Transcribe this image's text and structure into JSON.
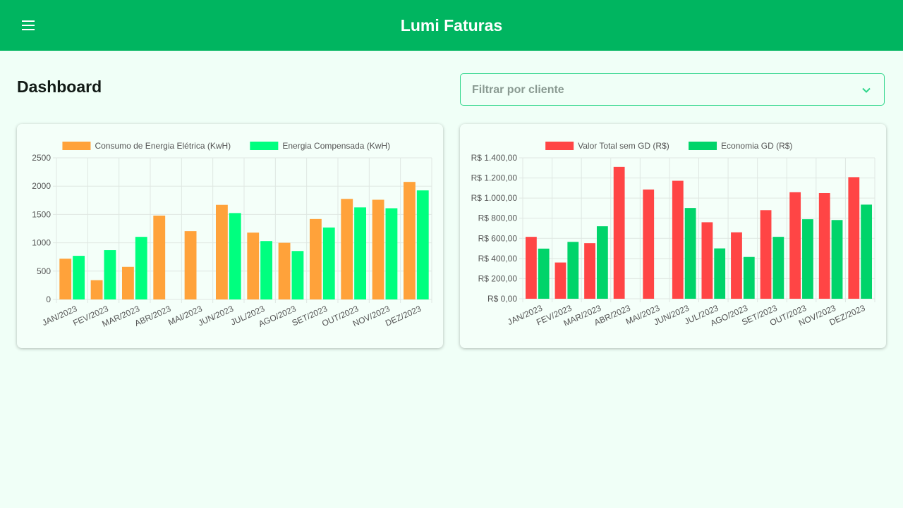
{
  "header": {
    "title": "Lumi Faturas"
  },
  "page": {
    "title": "Dashboard"
  },
  "filter": {
    "placeholder": "Filtrar por cliente"
  },
  "icons": {
    "menu": "hamburger-menu-icon",
    "dropdown": "chevron-down-icon"
  },
  "colors": {
    "header": "#00b560",
    "background": "#f0fff7",
    "orange": "#ffa23a",
    "green_bright": "#00ff7f",
    "red": "#ff4545",
    "green": "#00d46a"
  },
  "chart_data": [
    {
      "type": "bar",
      "categories": [
        "JAN/2023",
        "FEV/2023",
        "MAR/2023",
        "ABR/2023",
        "MAI/2023",
        "JUN/2023",
        "JUL/2023",
        "AGO/2023",
        "SET/2023",
        "OUT/2023",
        "NOV/2023",
        "DEZ/2023"
      ],
      "series": [
        {
          "name": "Consumo de Energia Elétrica (KwH)",
          "color": "#ffa23a",
          "values": [
            720,
            340,
            575,
            1480,
            1205,
            1670,
            1180,
            1000,
            1420,
            1775,
            1760,
            2075
          ]
        },
        {
          "name": "Energia Compensada (KwH)",
          "color": "#00ff7f",
          "values": [
            770,
            870,
            1105,
            0,
            0,
            1525,
            1030,
            855,
            1270,
            1625,
            1610,
            1925
          ]
        }
      ],
      "yticks": [
        "0",
        "500",
        "1000",
        "1500",
        "2000",
        "2500"
      ],
      "ylim": [
        0,
        2500
      ],
      "legend": "top",
      "grid": true
    },
    {
      "type": "bar",
      "categories": [
        "JAN/2023",
        "FEV/2023",
        "MAR/2023",
        "ABR/2023",
        "MAI/2023",
        "JUN/2023",
        "JUL/2023",
        "AGO/2023",
        "SET/2023",
        "OUT/2023",
        "NOV/2023",
        "DEZ/2023"
      ],
      "series": [
        {
          "name": "Valor Total sem GD (R$)",
          "color": "#ff4545",
          "values": [
            615,
            360,
            552,
            1310,
            1085,
            1172,
            760,
            660,
            880,
            1058,
            1050,
            1208
          ]
        },
        {
          "name": "Economia GD (R$)",
          "color": "#00d46a",
          "values": [
            498,
            565,
            720,
            0,
            0,
            902,
            500,
            415,
            615,
            790,
            782,
            935
          ]
        }
      ],
      "yticks": [
        "R$ 0,00",
        "R$ 200,00",
        "R$ 400,00",
        "R$ 600,00",
        "R$ 800,00",
        "R$ 1.000,00",
        "R$ 1.200,00",
        "R$ 1.400,00"
      ],
      "ylim": [
        0,
        1400
      ],
      "legend": "top",
      "grid": true
    }
  ]
}
